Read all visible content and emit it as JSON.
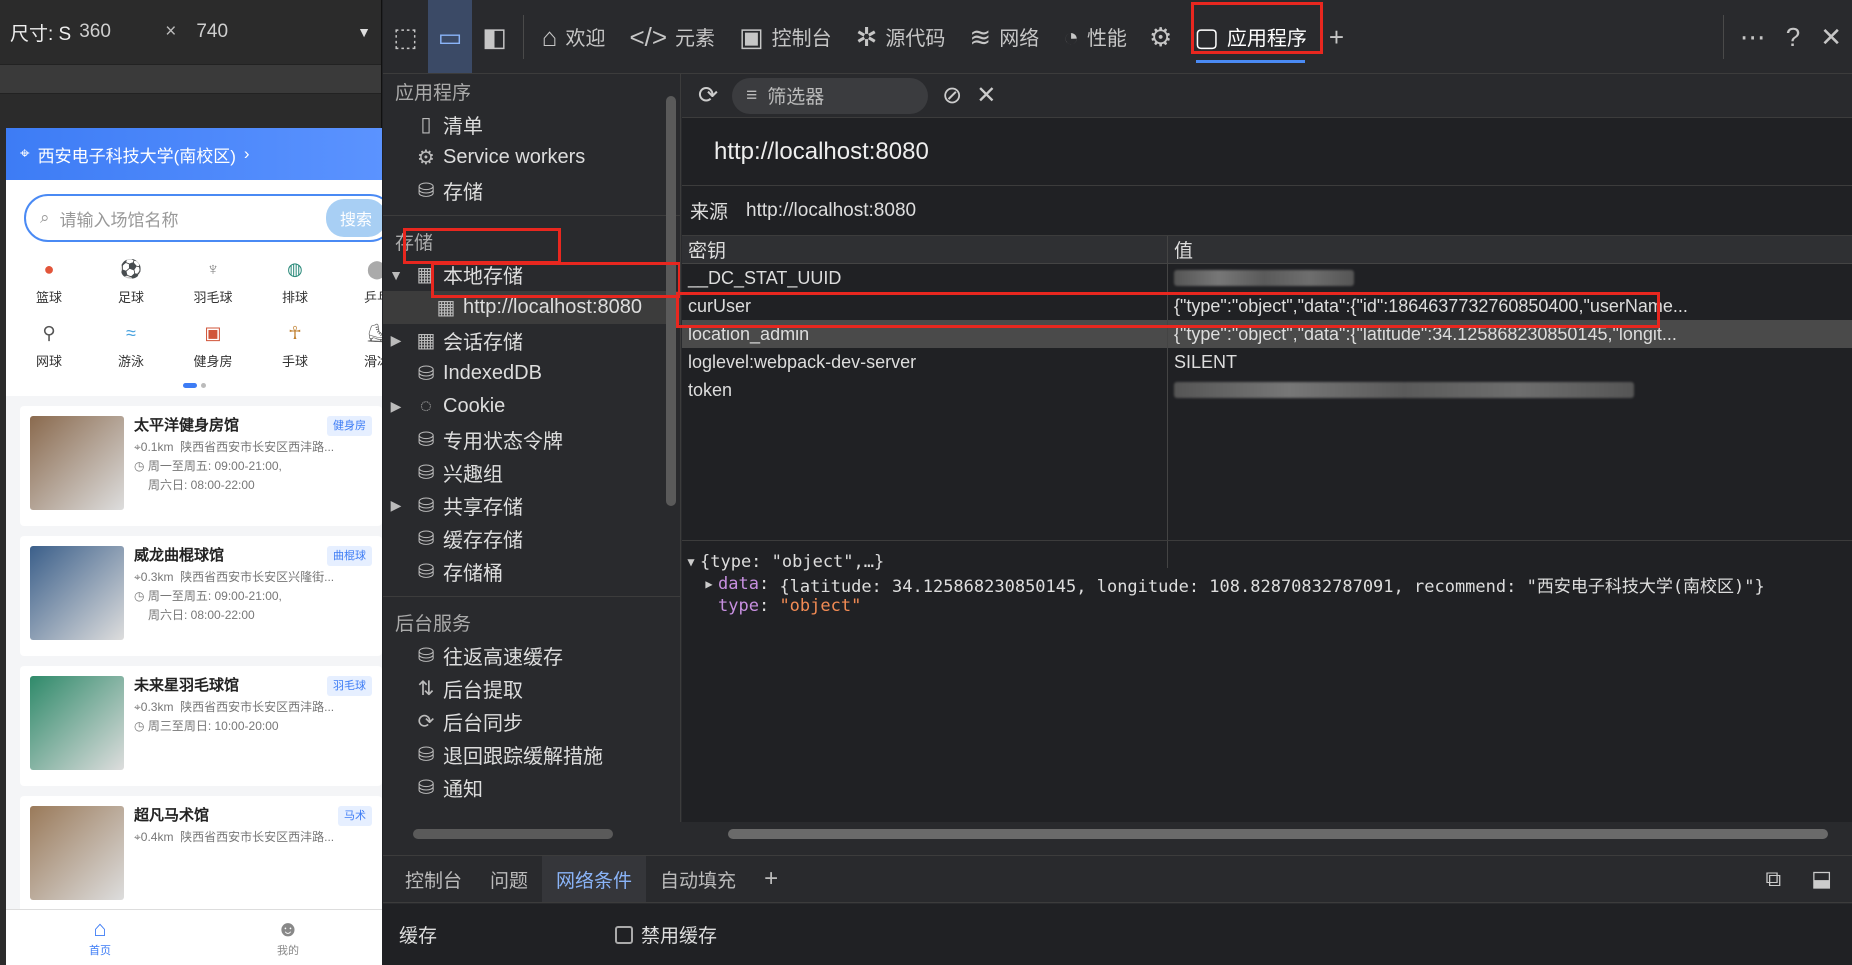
{
  "device": {
    "size_label": "尺寸: S",
    "width": "360",
    "times": "×",
    "height": "740",
    "phone": {
      "location": "西安电子科技大学(南校区)",
      "search_placeholder": "请输入场馆名称",
      "search_button": "搜索",
      "categories": [
        {
          "label": "篮球",
          "icon": "basketball-icon"
        },
        {
          "label": "足球",
          "icon": "football-icon"
        },
        {
          "label": "羽毛球",
          "icon": "shuttlecock-icon"
        },
        {
          "label": "排球",
          "icon": "volleyball-icon"
        },
        {
          "label": "乒乓",
          "icon": "pingpong-icon"
        },
        {
          "label": "网球",
          "icon": "tennis-icon"
        },
        {
          "label": "游泳",
          "icon": "swim-icon"
        },
        {
          "label": "健身房",
          "icon": "gym-icon"
        },
        {
          "label": "手球",
          "icon": "handball-icon"
        },
        {
          "label": "滑冰",
          "icon": "skate-icon"
        }
      ],
      "venues": [
        {
          "title": "太平洋健身房馆",
          "tag": "健身房",
          "distance": "0.1km",
          "address": "陕西省西安市长安区西沣路...",
          "hours1": "周一至周五: 09:00-21:00,",
          "hours2": "周六日: 08:00-22:00",
          "color": "#8a6a4e"
        },
        {
          "title": "威龙曲棍球馆",
          "tag": "曲棍球",
          "distance": "0.3km",
          "address": "陕西省西安市长安区兴隆街...",
          "hours1": "周一至周五: 09:00-21:00,",
          "hours2": "周六日: 08:00-22:00",
          "color": "#3b5f8a"
        },
        {
          "title": "未来星羽毛球馆",
          "tag": "羽毛球",
          "distance": "0.3km",
          "address": "陕西省西安市长安区西沣路...",
          "hours1": "周三至周日: 10:00-20:00",
          "hours2": "",
          "color": "#2f8a6a"
        },
        {
          "title": "超凡马术馆",
          "tag": "马术",
          "distance": "0.4km",
          "address": "陕西省西安市长安区西沣路...",
          "hours1": "",
          "hours2": "",
          "color": "#9a7a5a"
        }
      ],
      "tabs": [
        {
          "label": "首页",
          "icon": "home-icon"
        },
        {
          "label": "我的",
          "icon": "user-icon"
        }
      ]
    }
  },
  "devtools": {
    "tabs": [
      {
        "label": "欢迎",
        "icon": "home-icon"
      },
      {
        "label": "元素",
        "icon": "code-icon"
      },
      {
        "label": "控制台",
        "icon": "console-icon"
      },
      {
        "label": "源代码",
        "icon": "bug-icon"
      },
      {
        "label": "网络",
        "icon": "wifi-icon"
      },
      {
        "label": "性能",
        "icon": "gauge-icon"
      },
      {
        "label": "应用程序",
        "icon": "app-icon"
      }
    ],
    "sidebar": {
      "section_app": "应用程序",
      "app_items": [
        "清单",
        "Service workers",
        "存储"
      ],
      "section_storage": "存储",
      "storage_items": [
        "本地存储",
        "会话存储",
        "IndexedDB",
        "Cookie",
        "专用状态令牌",
        "兴趣组",
        "共享存储",
        "缓存存储",
        "存储桶"
      ],
      "local_child": "http://localhost:8080",
      "section_bg": "后台服务",
      "bg_items": [
        "往返高速缓存",
        "后台提取",
        "后台同步",
        "退回跟踪缓解措施",
        "通知"
      ]
    },
    "toolbar": {
      "filter_placeholder": "筛选器"
    },
    "origin": "http://localhost:8080",
    "source_label": "来源",
    "source_value": "http://localhost:8080",
    "table": {
      "col_key": "密钥",
      "col_value": "值",
      "rows": [
        {
          "key": "__DC_STAT_UUID",
          "value": ""
        },
        {
          "key": "curUser",
          "value": "{\"type\":\"object\",\"data\":{\"id\":1864637732760850400,\"userName..."
        },
        {
          "key": "location_admin",
          "value": "{\"type\":\"object\",\"data\":{\"latitude\":34.125868230850145,\"longit..."
        },
        {
          "key": "loglevel:webpack-dev-server",
          "value": "SILENT"
        },
        {
          "key": "token",
          "value": ""
        }
      ]
    },
    "preview": {
      "line1": "{type: \"object\",…}",
      "data_key": "data",
      "data_val": "{latitude: 34.125868230850145, longitude: 108.82870832787091, recommend: \"西安电子科技大学(南校区)\"}",
      "type_key": "type",
      "type_val": "\"object\""
    },
    "drawer": {
      "tabs": [
        "控制台",
        "问题",
        "网络条件",
        "自动填充"
      ],
      "section": "缓存",
      "checkbox_label": "禁用缓存"
    }
  },
  "colors": {
    "highlight": "#e8271f",
    "accent": "#4a8af4"
  }
}
